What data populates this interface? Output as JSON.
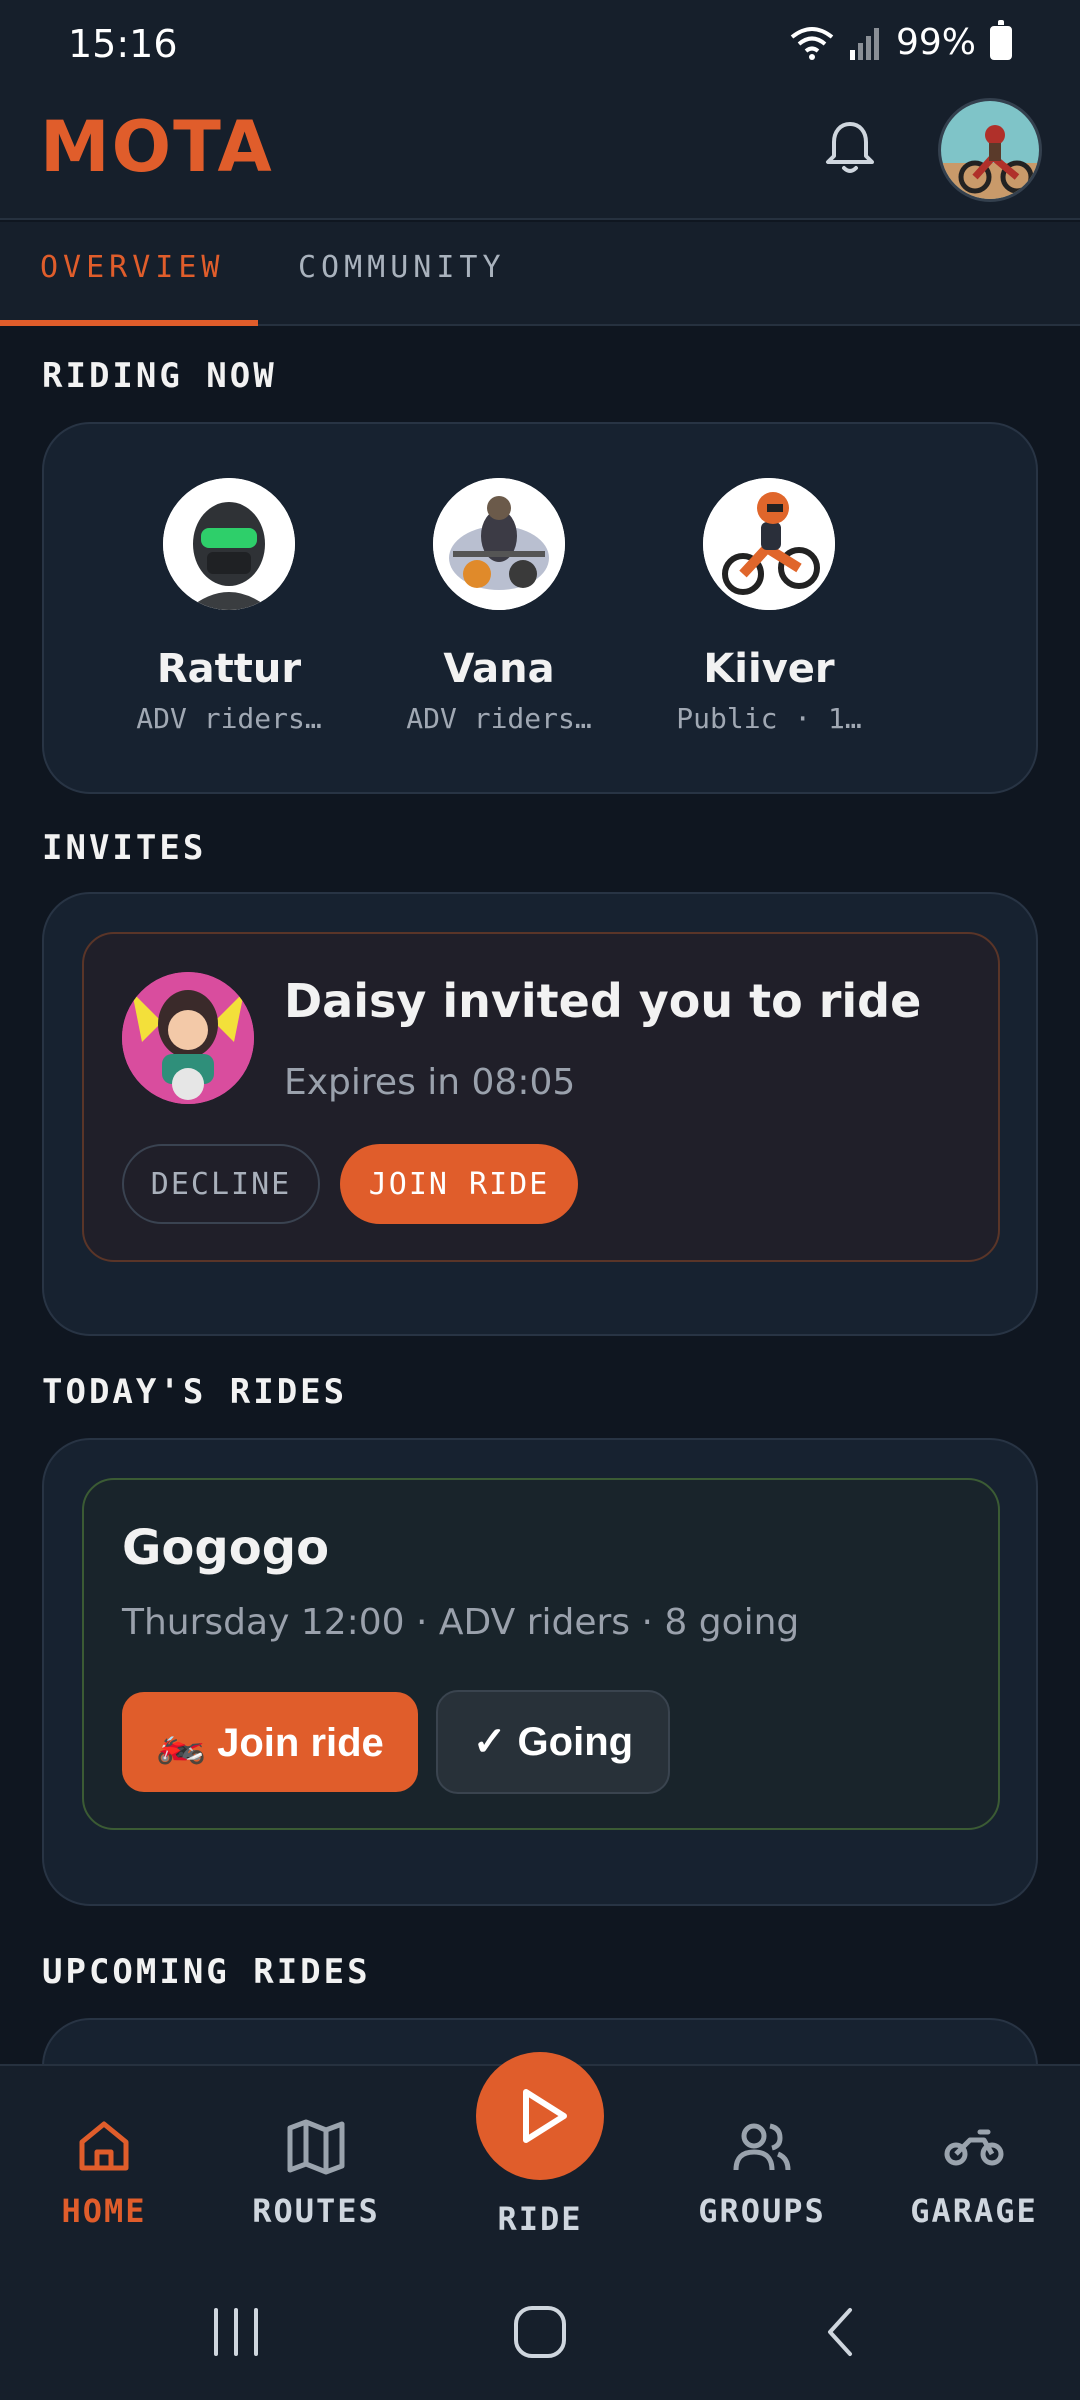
{
  "status_bar": {
    "time": "15:16",
    "battery": "99%"
  },
  "header": {
    "logo": "MOTA"
  },
  "tabs": [
    {
      "label": "OVERVIEW"
    },
    {
      "label": "COMMUNITY"
    }
  ],
  "sections": {
    "riding_now": "RIDING NOW",
    "invites": "INVITES",
    "todays_rides": "TODAY'S RIDES",
    "upcoming_rides": "UPCOMING RIDES"
  },
  "riding_now": [
    {
      "name": "Rattur",
      "subtitle": "ADV riders…"
    },
    {
      "name": "Vana",
      "subtitle": "ADV riders…"
    },
    {
      "name": "Kiiver",
      "subtitle": "Public · 1…"
    }
  ],
  "invite": {
    "title": "Daisy invited you to ride",
    "subtitle": "Expires in 08:05",
    "decline_label": "DECLINE",
    "join_label": "JOIN RIDE"
  },
  "today_ride": {
    "title": "Gogogo",
    "subtitle": "Thursday 12:00 · ADV riders · 8 going",
    "join_label": "🏍️ Join ride",
    "going_label": "✓ Going"
  },
  "bottom_nav": {
    "home": "HOME",
    "routes": "ROUTES",
    "ride": "RIDE",
    "groups": "GROUPS",
    "garage": "GARAGE"
  },
  "colors": {
    "accent": "#e05d2b",
    "background": "#0f1620",
    "card": "#172230"
  }
}
